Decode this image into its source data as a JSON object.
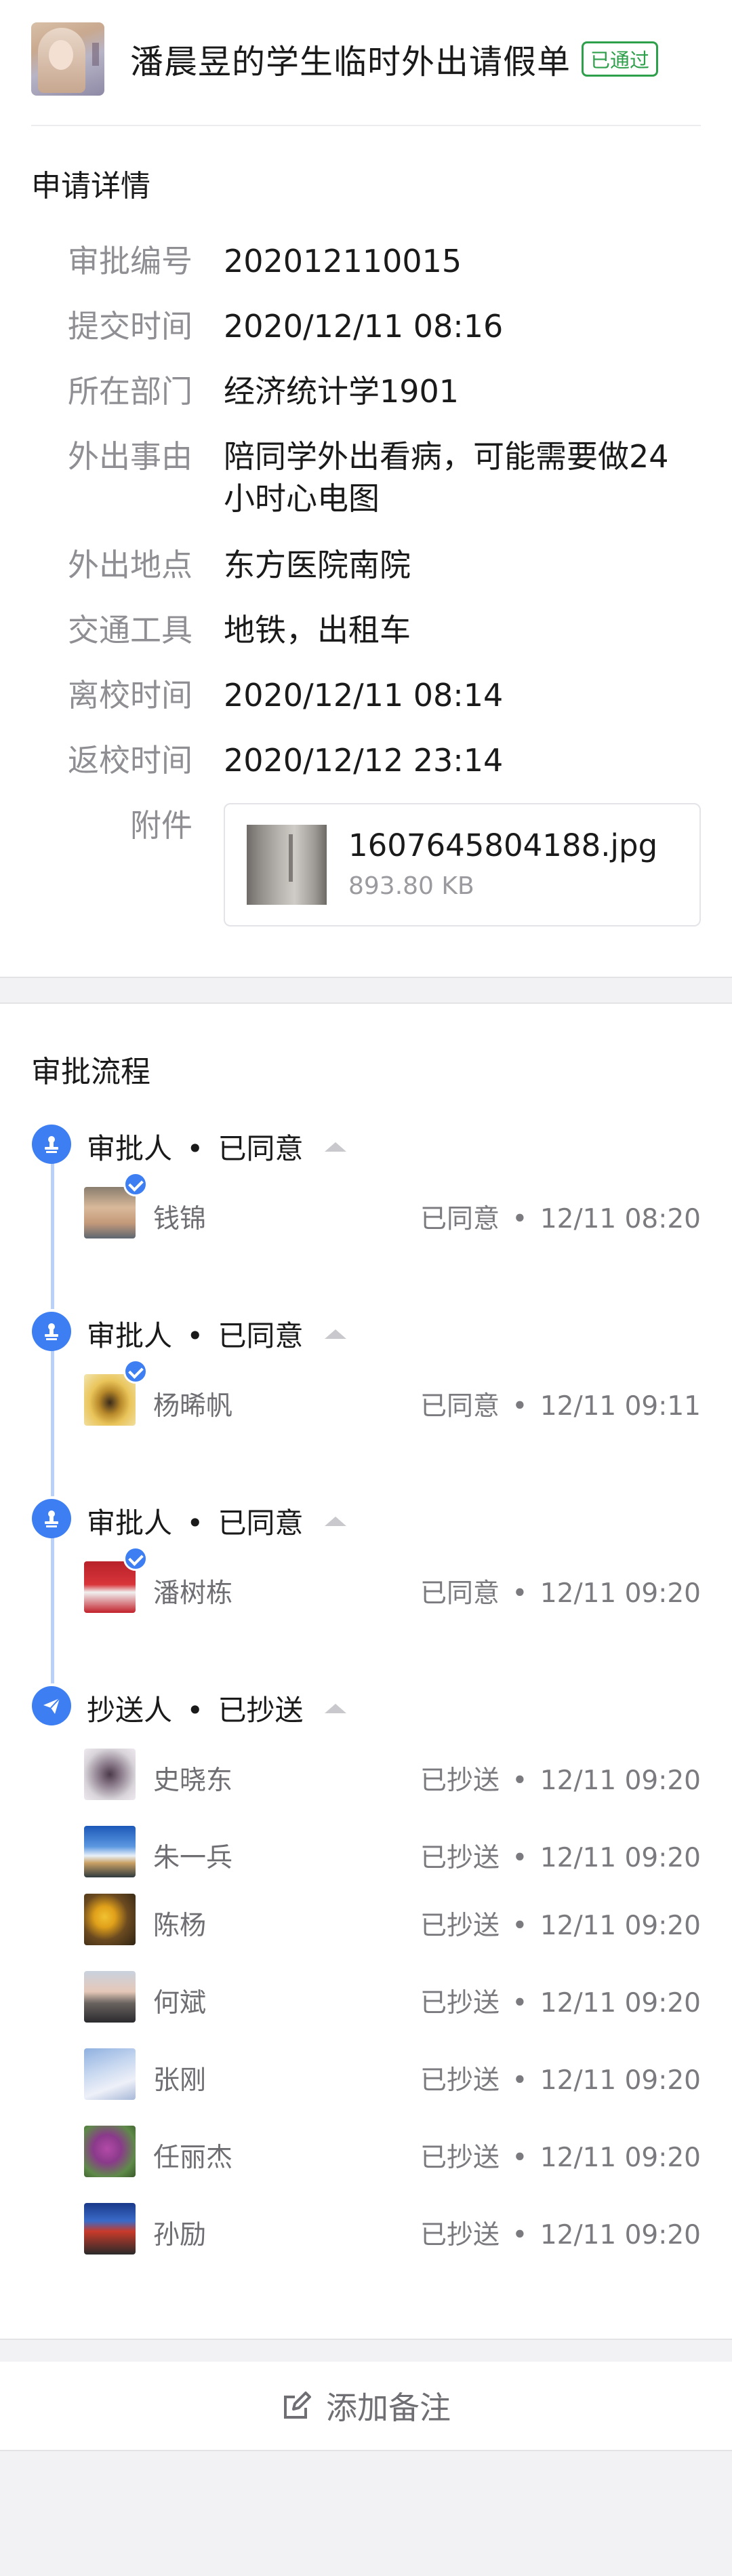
{
  "header": {
    "title": "潘晨昱的学生临时外出请假单",
    "status_badge": "已通过"
  },
  "details": {
    "section_title": "申请详情",
    "rows": [
      {
        "label": "审批编号",
        "value": "202012110015"
      },
      {
        "label": "提交时间",
        "value": "2020/12/11 08:16"
      },
      {
        "label": "所在部门",
        "value": "经济统计学1901"
      },
      {
        "label": "外出事由",
        "value": "陪同学外出看病，可能需要做24小时心电图"
      },
      {
        "label": "外出地点",
        "value": "东方医院南院"
      },
      {
        "label": "交通工具",
        "value": "地铁，出租车"
      },
      {
        "label": "离校时间",
        "value": "2020/12/11 08:14"
      },
      {
        "label": "返校时间",
        "value": "2020/12/12 23:14"
      }
    ],
    "attachment": {
      "label": "附件",
      "file_name": "1607645804188.jpg",
      "file_size": "893.80 KB"
    }
  },
  "flow": {
    "section_title": "审批流程",
    "separator": "•",
    "steps": [
      {
        "role": "审批人",
        "status": "已同意",
        "icon": "stamp-icon",
        "people": [
          {
            "name": "钱锦",
            "status": "已同意",
            "time": "12/11 08:20"
          }
        ]
      },
      {
        "role": "审批人",
        "status": "已同意",
        "icon": "stamp-icon",
        "people": [
          {
            "name": "杨晞帆",
            "status": "已同意",
            "time": "12/11 09:11"
          }
        ]
      },
      {
        "role": "审批人",
        "status": "已同意",
        "icon": "stamp-icon",
        "people": [
          {
            "name": "潘树栋",
            "status": "已同意",
            "time": "12/11 09:20"
          }
        ]
      },
      {
        "role": "抄送人",
        "status": "已抄送",
        "icon": "paper-plane-icon",
        "people": [
          {
            "name": "史晓东",
            "status": "已抄送",
            "time": "12/11 09:20"
          },
          {
            "name": "朱一兵",
            "status": "已抄送",
            "time": "12/11 09:20"
          },
          {
            "name": "陈杨",
            "status": "已抄送",
            "time": "12/11 09:20"
          },
          {
            "name": "何斌",
            "status": "已抄送",
            "time": "12/11 09:20"
          },
          {
            "name": "张刚",
            "status": "已抄送",
            "time": "12/11 09:20"
          },
          {
            "name": "任丽杰",
            "status": "已抄送",
            "time": "12/11 09:20"
          },
          {
            "name": "孙励",
            "status": "已抄送",
            "time": "12/11 09:20"
          }
        ]
      }
    ]
  },
  "footer": {
    "add_note_label": "添加备注"
  },
  "colors": {
    "accent": "#3d7ff2",
    "approved_green": "#2e9f4a",
    "timeline": "#b9d1f8"
  }
}
